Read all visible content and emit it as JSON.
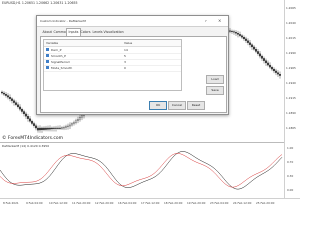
{
  "chart": {
    "symbol_title": "EURUSD,H1  1.20651 1.20662 1.20631 1.20655",
    "watermark": "© ForexMT4Indicators.com",
    "indicator_title": "DeMarkerM (14) 0.4120 0.3950",
    "price_labels": [
      "1.2065",
      "1.2040",
      "1.2015",
      "1.1990",
      "1.1965",
      "1.1940",
      "1.1915",
      "1.1890",
      "1.1865"
    ],
    "indicator_labels": [
      "1.00",
      "0.70",
      "0.30",
      "0.00"
    ],
    "time_labels": [
      "8 Feb 2021",
      "9 Feb 04:00",
      "10 Feb 12:00",
      "11 Feb 20:00",
      "12 Feb 20:00",
      "16 Feb 04:00",
      "17 Feb 12:00",
      "18 Feb 20:00",
      "19 Feb 20:00",
      "23 Feb 04:00",
      "24 Feb 12:00",
      "25 Feb 20:00"
    ],
    "colors": {
      "bull": "#1a1a1a",
      "bear": "#1a1a1a",
      "line_main": "#1e1e1e",
      "line_signal": "#d93a3a"
    }
  },
  "dialog": {
    "title": "Custom Indicator - DeMarkerM",
    "window_controls": {
      "help": "?",
      "close": "×"
    },
    "tabs": [
      "About",
      "Common",
      "Inputs",
      "Colors",
      "Levels",
      "Visualization"
    ],
    "active_tab": "Inputs",
    "table": {
      "headers": [
        "Variable",
        "Value"
      ],
      "rows": [
        {
          "variable": "Dem_P",
          "value": "14"
        },
        {
          "variable": "Smooth_P",
          "value": "5"
        },
        {
          "variable": "SignalPeriod",
          "value": "3"
        },
        {
          "variable": "Mode_Smooth",
          "value": "0"
        }
      ]
    },
    "side_buttons": {
      "load": "Load",
      "save": "Save"
    },
    "footer_buttons": {
      "ok": "OK",
      "cancel": "Cancel",
      "reset": "Reset"
    }
  }
}
